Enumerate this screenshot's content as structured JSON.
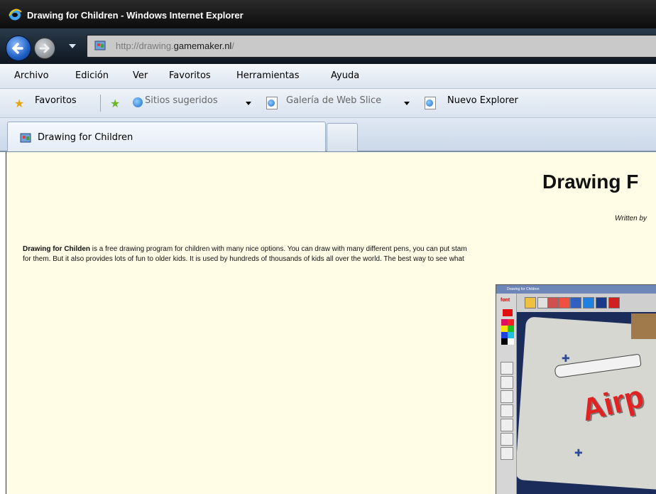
{
  "window": {
    "title": "Drawing for Children - Windows Internet Explorer"
  },
  "address": {
    "url_prefix": "http://drawing.",
    "url_domain": "gamemaker.nl",
    "url_suffix": "/"
  },
  "menu": [
    "Archivo",
    "Edición",
    "Ver",
    "Favoritos",
    "Herramientas",
    "Ayuda"
  ],
  "favorites_bar": {
    "favorites": "Favoritos",
    "suggested": "Sitios sugeridos",
    "webslice": "Galería de Web Slice",
    "new_explorer": "Nuevo Explorer"
  },
  "tabs": [
    {
      "label": "Drawing for Children"
    }
  ],
  "page": {
    "heading": "Drawing F",
    "byline": "Written by",
    "intro_bold": "Drawing for Childen",
    "intro_line1": " is a free drawing program for children with many nice options. You can draw with many different pens, you can put stam",
    "intro_line2": "for them. But it also provides lots of fun to older kids. It is used by hundreds of thousands of kids all over the world. The best way to see what",
    "screenshot": {
      "window_title": "Drawing for Children",
      "font_label": "font",
      "art_text": "Airp"
    }
  },
  "colors": {
    "page_bg": "#fffde6",
    "titlebar": "#0c0c0c",
    "accent_red": "#e22222"
  }
}
